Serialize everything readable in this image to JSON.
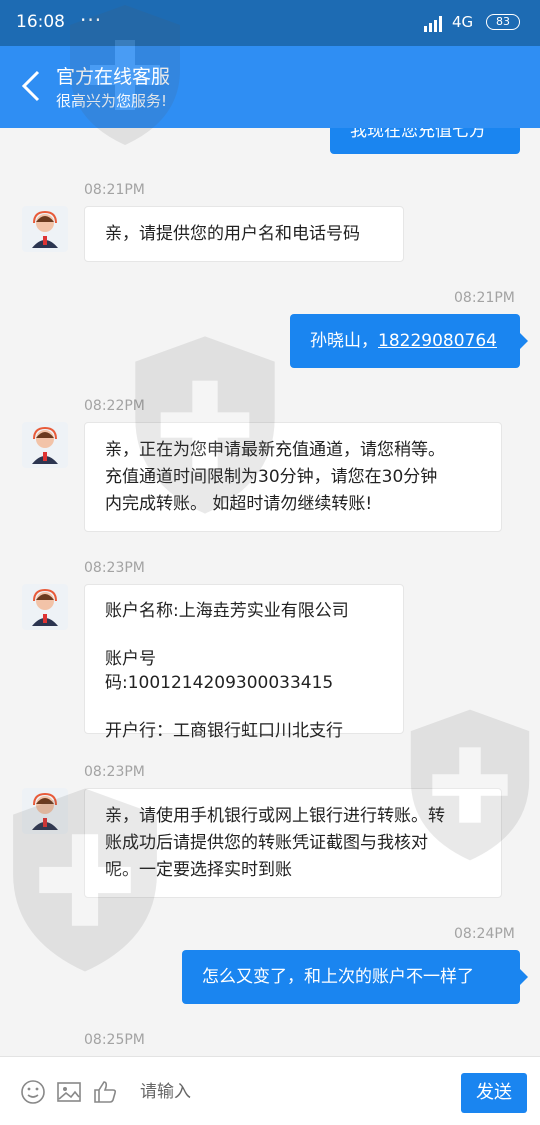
{
  "status_bar": {
    "time": "16:08",
    "dots": "···",
    "network": "4G",
    "battery": "83"
  },
  "header": {
    "title": "官方在线客服",
    "subtitle": "很高兴为您服务!"
  },
  "partial_message": "我现在您充值七方",
  "messages": [
    {
      "time": "08:21PM",
      "from": "agent",
      "lines": [
        "亲，请提供您的用户名和电话号码"
      ]
    },
    {
      "time": "08:21PM",
      "from": "user",
      "name": "孙晓山，",
      "phone": "18229080764"
    },
    {
      "time": "08:22PM",
      "from": "agent",
      "lines": [
        "亲，正在为您申请最新充值通道，请您稍等。",
        "充值通道时间限制为30分钟，请您在30分钟",
        "内完成转账。 如超时请勿继续转账!"
      ]
    },
    {
      "time": "08:23PM",
      "from": "agent",
      "lines": [
        "账户名称:上海垚芳实业有限公司",
        "账户号码:1001214209300033415",
        "开户行：工商银行虹口川北支行"
      ]
    },
    {
      "time": "08:23PM",
      "from": "agent",
      "lines": [
        "亲，请使用手机银行或网上银行进行转账。转",
        "账成功后请提供您的转账凭证截图与我核对",
        "呢。一定要选择实时到账"
      ]
    },
    {
      "time": "08:24PM",
      "from": "user",
      "text": "怎么又变了，和上次的账户不一样了"
    },
    {
      "time": "08:25PM",
      "from": "agent",
      "lines": []
    }
  ],
  "input_bar": {
    "placeholder": "请输入",
    "send_label": "发送"
  }
}
